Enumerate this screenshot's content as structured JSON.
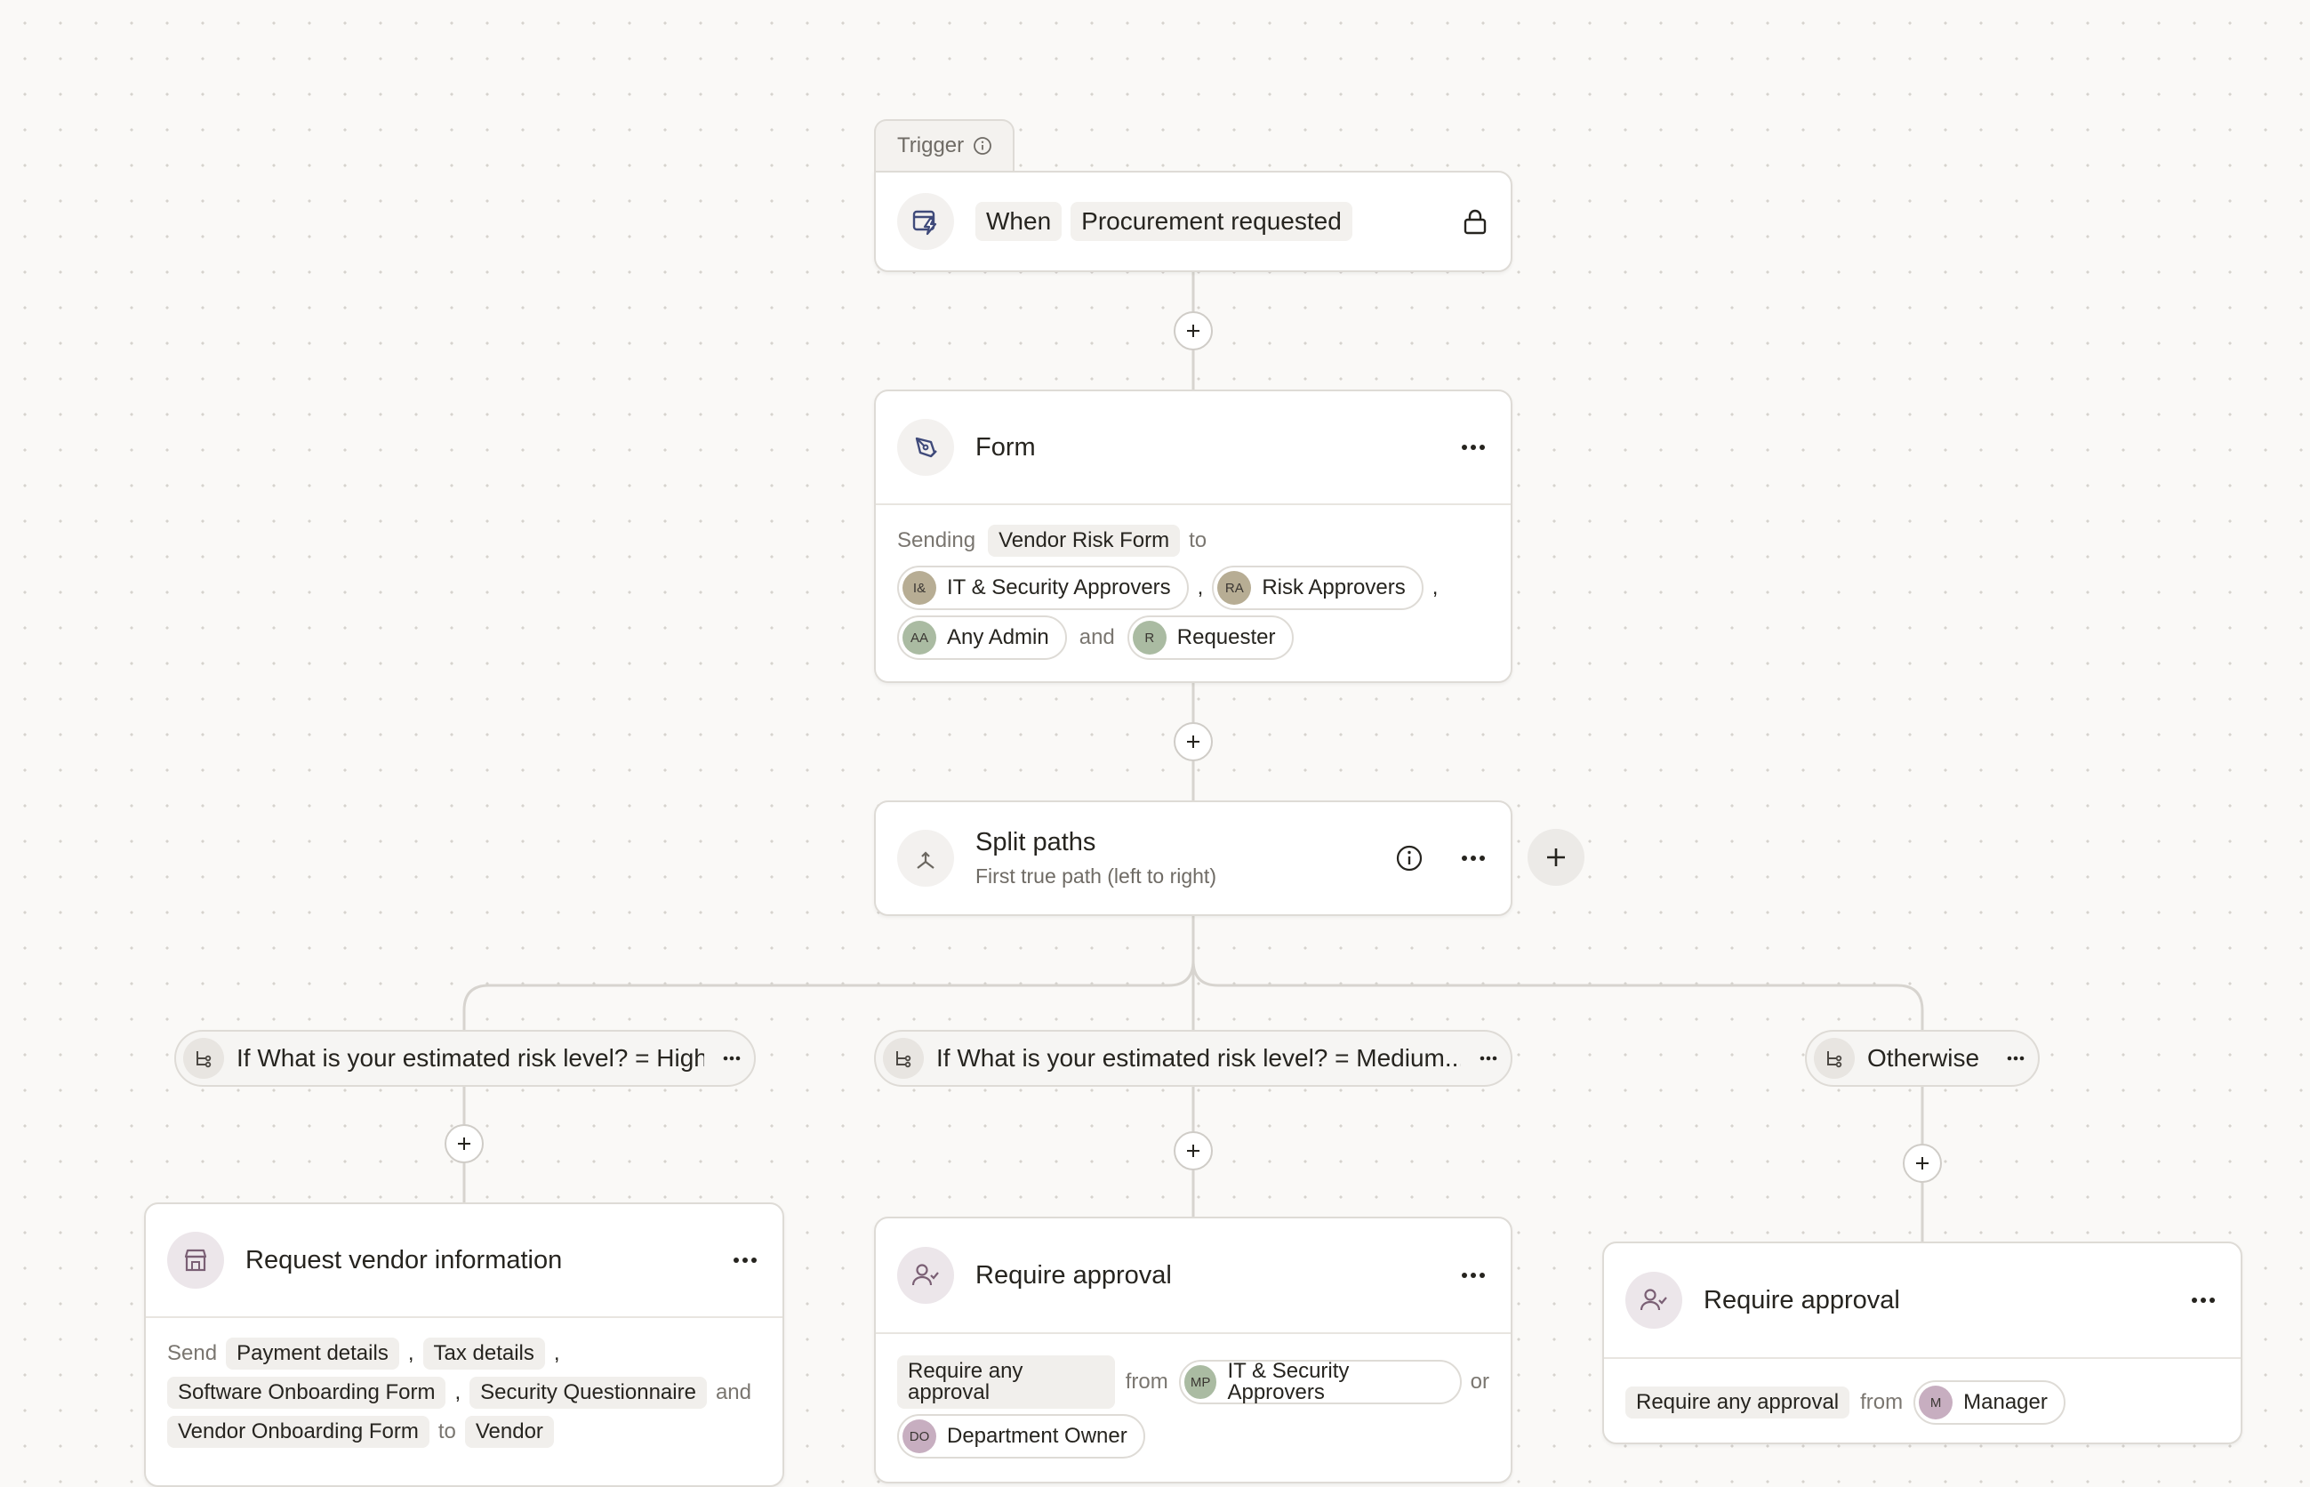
{
  "trigger": {
    "tab_label": "Trigger",
    "when_label": "When",
    "event": "Procurement requested"
  },
  "form_step": {
    "title": "Form",
    "sending_label": "Sending",
    "form_name": "Vendor Risk Form",
    "to_label": "to",
    "recipients": [
      {
        "initials": "I&",
        "name": "IT & Security Approvers",
        "color": "#b7ad94"
      },
      {
        "initials": "RA",
        "name": "Risk Approvers",
        "color": "#b7ad94"
      },
      {
        "initials": "AA",
        "name": "Any Admin",
        "color": "#aabba2"
      },
      {
        "initials": "R",
        "name": "Requester",
        "color": "#aabba2"
      }
    ],
    "comma": ",",
    "and_label": "and"
  },
  "split": {
    "title": "Split paths",
    "subtitle": "First true path (left to right)"
  },
  "branches": [
    {
      "label": "If What is your estimated risk level? = High"
    },
    {
      "label": "If What is your estimated risk level? = Medium..."
    },
    {
      "label": "Otherwise"
    }
  ],
  "vendor_step": {
    "title": "Request vendor information",
    "send_label": "Send",
    "items": [
      "Payment details",
      "Tax details",
      "Software Onboarding Form",
      "Security Questionnaire",
      "Vendor Onboarding Form"
    ],
    "comma": ",",
    "and_label": "and",
    "to_label": "to",
    "target": "Vendor"
  },
  "approval_medium": {
    "title": "Require approval",
    "rule": "Require any approval",
    "from_label": "from",
    "or_label": "or",
    "approvers": [
      {
        "initials": "MP",
        "name": "IT & Security Approvers",
        "color": "#aabba2"
      },
      {
        "initials": "DO",
        "name": "Department Owner",
        "color": "#c7aec0"
      }
    ]
  },
  "approval_otherwise": {
    "title": "Require approval",
    "rule": "Require any approval",
    "from_label": "from",
    "approvers": [
      {
        "initials": "M",
        "name": "Manager",
        "color": "#c7aec0"
      }
    ]
  },
  "colors": {
    "background": "#faf9f7",
    "card_border": "#dedbd6",
    "connector": "#d7d4cf",
    "icon_blue": "#3f4a7a",
    "icon_mauve": "#7a5f74"
  }
}
